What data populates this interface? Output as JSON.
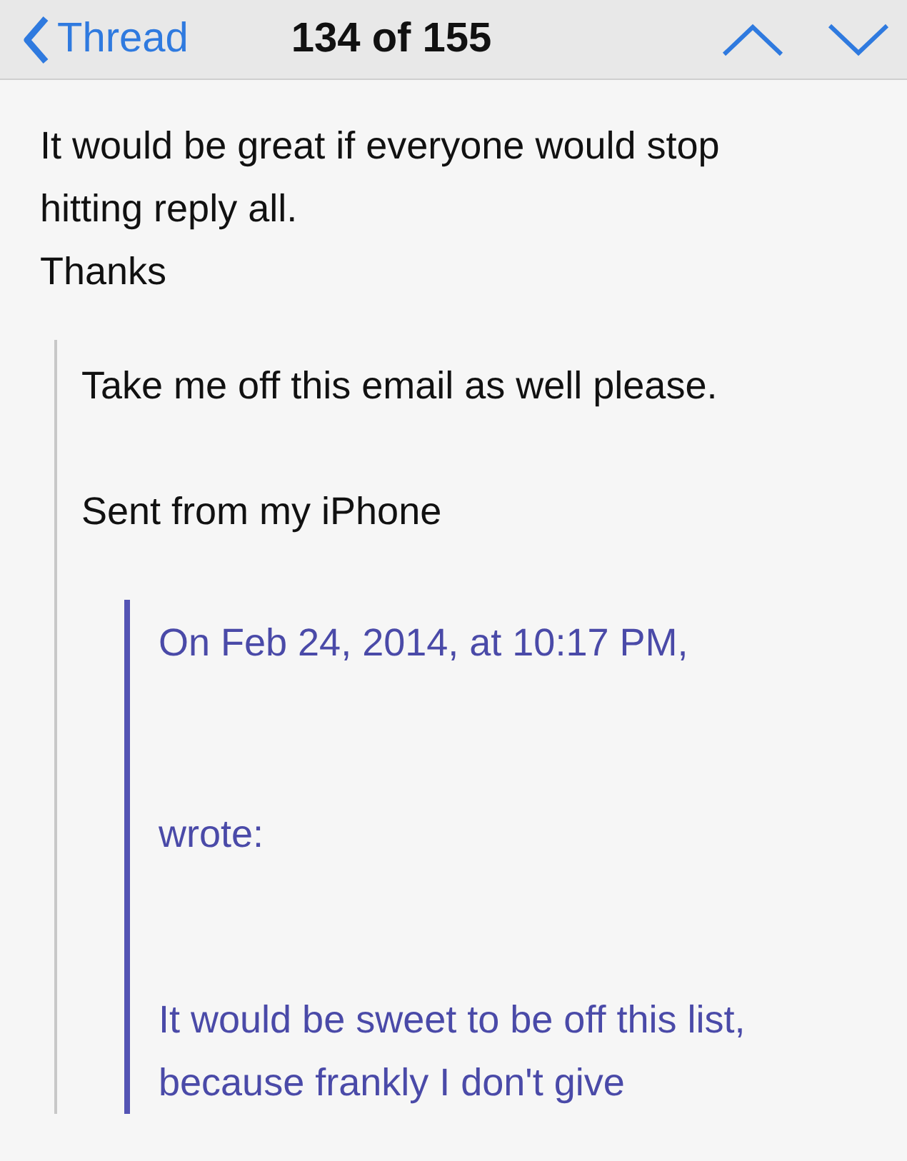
{
  "nav_bar": {
    "back_label": "Thread",
    "position": "134 of 155"
  },
  "message": {
    "paragraphs": [
      "It would be great if everyone would stop hitting reply all.",
      "Thanks"
    ],
    "quote": {
      "paragraphs": [
        "Take me off this email as well please.",
        "Sent from my iPhone"
      ],
      "quote": {
        "header": "On Feb 24, 2014, at 10:17 PM,",
        "wrote": "wrote:",
        "paragraphs": [
          "It would be sweet to be off this list, because frankly I don't give"
        ]
      }
    }
  }
}
